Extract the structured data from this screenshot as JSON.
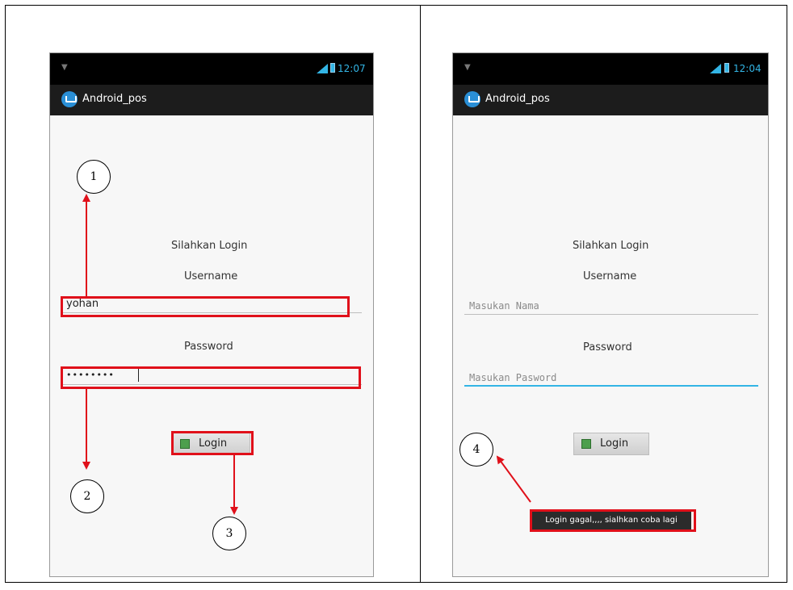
{
  "screen1": {
    "status_time": "12:07",
    "app_title": "Android_pos",
    "heading": "Silahkan Login",
    "username_label": "Username",
    "username_value": "yohan",
    "password_label": "Password",
    "password_value": "••••••••",
    "login_button": "Login"
  },
  "screen2": {
    "status_time": "12:04",
    "app_title": "Android_pos",
    "heading": "Silahkan Login",
    "username_label": "Username",
    "username_placeholder": "Masukan Nama",
    "password_label": "Password",
    "password_placeholder": "Masukan Pasword",
    "login_button": "Login",
    "toast": "Login gagal,,,, sialhkan coba lagi"
  },
  "annotations": [
    "1",
    "2",
    "3",
    "4"
  ],
  "colors": {
    "annotation_red": "#e0101a",
    "status_accent": "#33b5e5"
  }
}
